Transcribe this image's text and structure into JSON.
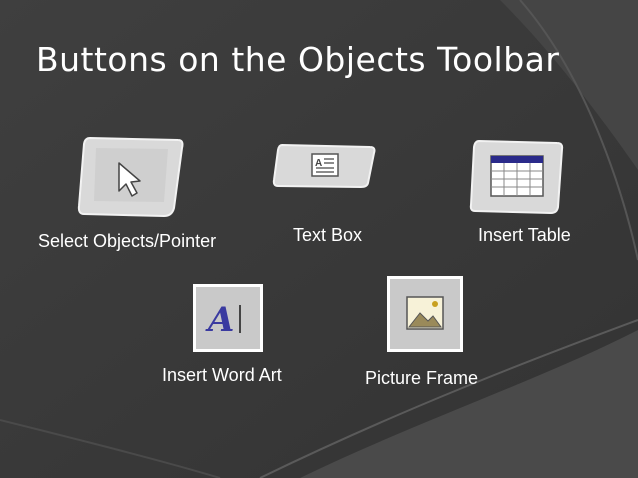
{
  "slide": {
    "title": "Buttons on the Objects Toolbar",
    "buttons": [
      {
        "label": "Select Objects/Pointer",
        "icon": "pointer-arrow-icon"
      },
      {
        "label": "Text Box",
        "icon": "text-box-icon"
      },
      {
        "label": "Insert Table",
        "icon": "table-icon"
      },
      {
        "label": "Insert Word Art",
        "icon": "word-art-icon"
      },
      {
        "label": "Picture Frame",
        "icon": "picture-icon"
      }
    ]
  },
  "colors": {
    "background": "#3a3a3a",
    "text": "#ffffff",
    "button_face": "#c9c9c9"
  }
}
